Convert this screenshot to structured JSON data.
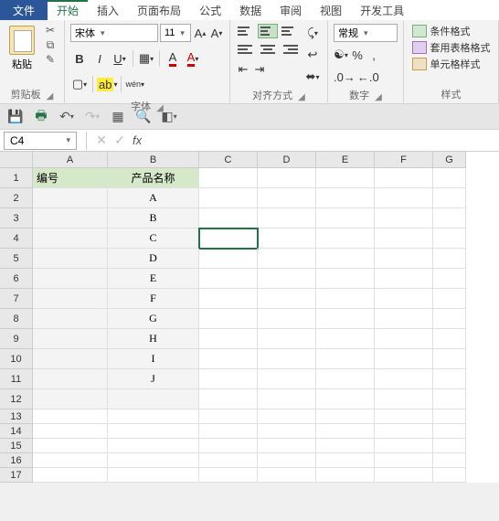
{
  "menu": {
    "file": "文件",
    "home": "开始",
    "insert": "插入",
    "pagelayout": "页面布局",
    "formulas": "公式",
    "data": "数据",
    "review": "审阅",
    "view": "视图",
    "developer": "开发工具"
  },
  "ribbon": {
    "clipboard": {
      "paste": "粘贴",
      "label": "剪贴板"
    },
    "font": {
      "name": "宋体",
      "size": "11",
      "label": "字体"
    },
    "alignment": {
      "label": "对齐方式"
    },
    "number": {
      "format": "常规",
      "label": "数字"
    },
    "styles": {
      "conditional": "条件格式",
      "table": "套用表格格式",
      "cell": "单元格样式",
      "label": "样式"
    }
  },
  "namebox": "C4",
  "fx": "fx",
  "columns": [
    "A",
    "B",
    "C",
    "D",
    "E",
    "F",
    "G"
  ],
  "sheet": {
    "headers": {
      "a": "编号",
      "b": "产品名称"
    },
    "rows": [
      {
        "n": "1",
        "a": "编号",
        "b": "产品名称",
        "hdr": true,
        "tall": true
      },
      {
        "n": "2",
        "a": "",
        "b": "A",
        "tall": true
      },
      {
        "n": "3",
        "a": "",
        "b": "B",
        "tall": true
      },
      {
        "n": "4",
        "a": "",
        "b": "C",
        "tall": true,
        "sel": true
      },
      {
        "n": "5",
        "a": "",
        "b": "D",
        "tall": true
      },
      {
        "n": "6",
        "a": "",
        "b": "E",
        "tall": true
      },
      {
        "n": "7",
        "a": "",
        "b": "F",
        "tall": true
      },
      {
        "n": "8",
        "a": "",
        "b": "G",
        "tall": true
      },
      {
        "n": "9",
        "a": "",
        "b": "H",
        "tall": true
      },
      {
        "n": "10",
        "a": "",
        "b": "I",
        "tall": true
      },
      {
        "n": "11",
        "a": "",
        "b": "J",
        "tall": true
      },
      {
        "n": "12",
        "a": "",
        "b": "",
        "tall": true,
        "shade": true
      },
      {
        "n": "13",
        "a": "",
        "b": ""
      },
      {
        "n": "14",
        "a": "",
        "b": ""
      },
      {
        "n": "15",
        "a": "",
        "b": ""
      },
      {
        "n": "16",
        "a": "",
        "b": ""
      },
      {
        "n": "17",
        "a": "",
        "b": ""
      }
    ]
  }
}
